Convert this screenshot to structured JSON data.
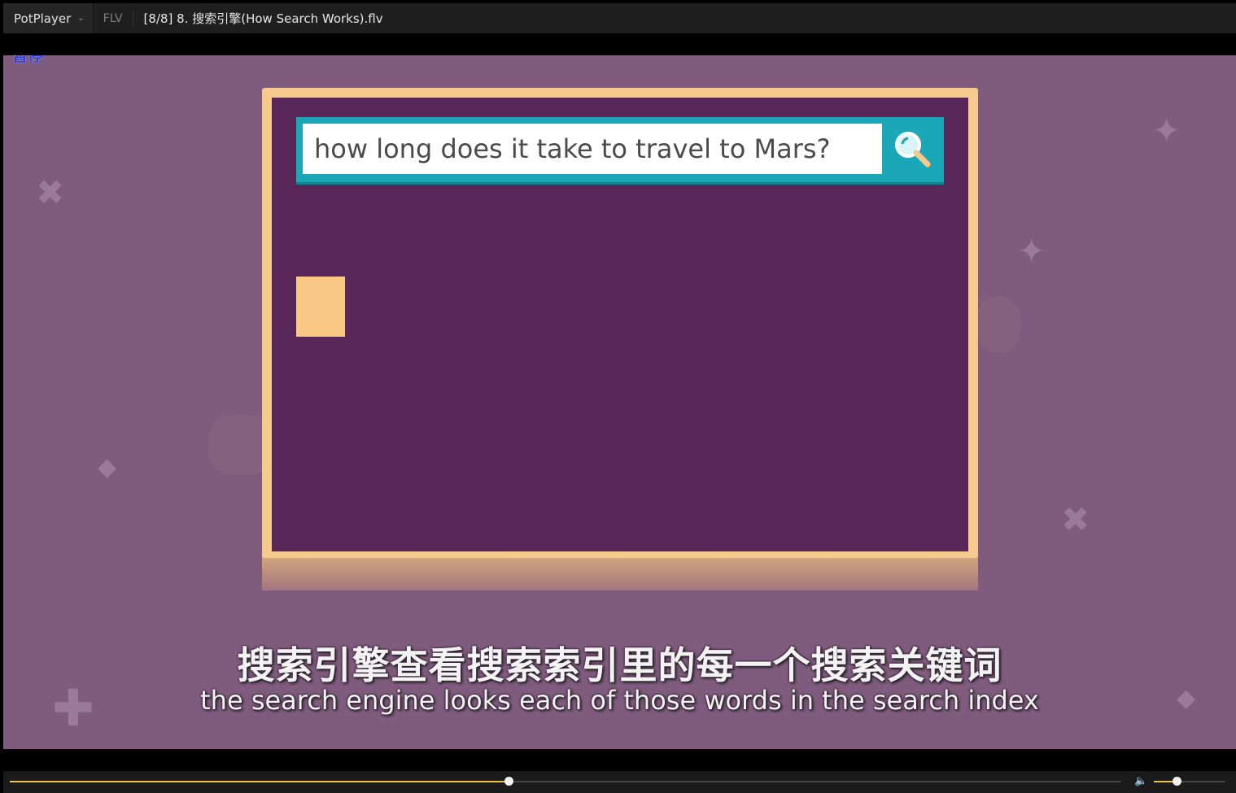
{
  "titlebar": {
    "app_name": "PotPlayer",
    "format": "FLV",
    "file_title": "[8/8] 8. 搜索引擎(How Search Works).flv"
  },
  "osd": {
    "status_text": "暂停"
  },
  "video": {
    "search_query": "how long does it take to travel to Mars?",
    "subtitle_cn": "搜索引擎查看搜索索引里的每一个搜索关键词",
    "subtitle_en": "the search engine looks each of those words in the search index"
  },
  "controls": {
    "seek_progress": 0.449,
    "volume_level": 0.32
  },
  "colors": {
    "background": "#7f5c7e",
    "screen": "#582757",
    "frame": "#f6c98c",
    "search_accent": "#1aa8b9",
    "progress": "#e9c44a"
  }
}
